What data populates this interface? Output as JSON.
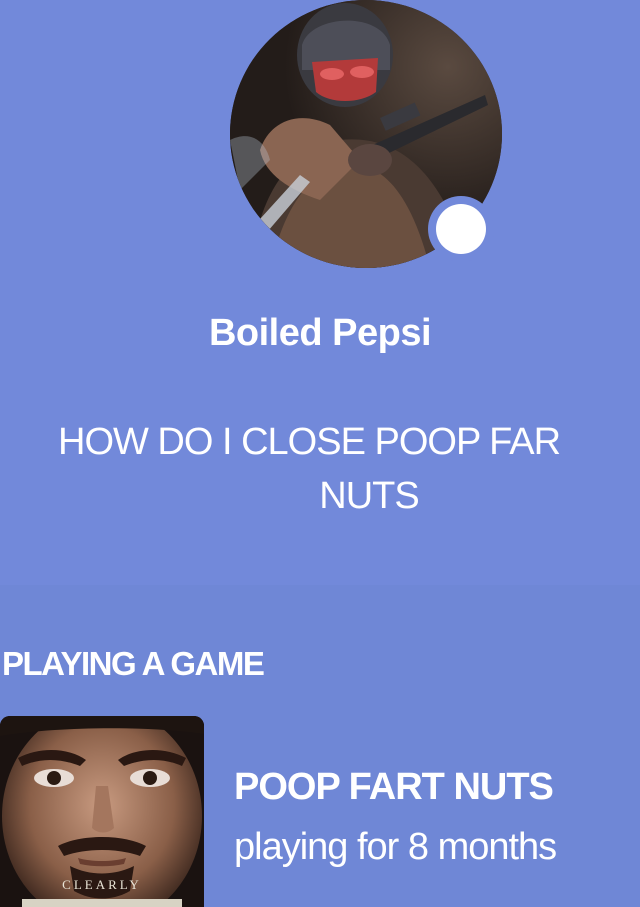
{
  "profile": {
    "username": "Boiled Pepsi",
    "custom_status_line1": "HOW DO I CLOSE POOP FAR",
    "custom_status_line2": "NUTS",
    "status": "online",
    "avatar_icon": "soldier-with-gun-avatar"
  },
  "activity": {
    "section_label": "PLAYING A GAME",
    "game_name": "POOP FART NUTS",
    "elapsed": "playing for 8 months",
    "icon_caption": "CLEARLY",
    "game_icon": "man-face-meme-icon"
  },
  "colors": {
    "background": "#7289da",
    "activity_background": "#6f87d6",
    "text": "#ffffff",
    "status_dot": "#ffffff"
  }
}
